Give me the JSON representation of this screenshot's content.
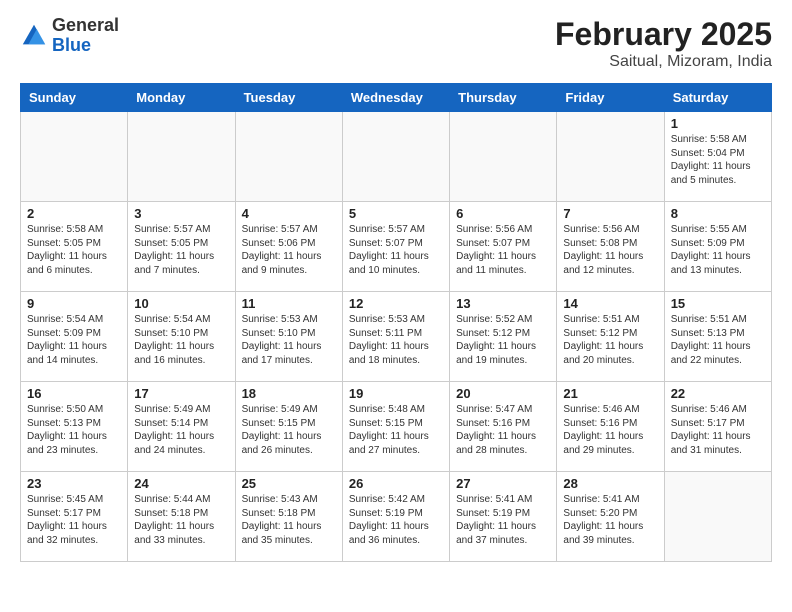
{
  "header": {
    "logo": {
      "general": "General",
      "blue": "Blue"
    },
    "title": "February 2025",
    "subtitle": "Saitual, Mizoram, India"
  },
  "calendar": {
    "days_of_week": [
      "Sunday",
      "Monday",
      "Tuesday",
      "Wednesday",
      "Thursday",
      "Friday",
      "Saturday"
    ],
    "weeks": [
      [
        {
          "day": null,
          "info": null
        },
        {
          "day": null,
          "info": null
        },
        {
          "day": null,
          "info": null
        },
        {
          "day": null,
          "info": null
        },
        {
          "day": null,
          "info": null
        },
        {
          "day": null,
          "info": null
        },
        {
          "day": "1",
          "info": "Sunrise: 5:58 AM\nSunset: 5:04 PM\nDaylight: 11 hours and 5 minutes."
        }
      ],
      [
        {
          "day": "2",
          "info": "Sunrise: 5:58 AM\nSunset: 5:05 PM\nDaylight: 11 hours and 6 minutes."
        },
        {
          "day": "3",
          "info": "Sunrise: 5:57 AM\nSunset: 5:05 PM\nDaylight: 11 hours and 7 minutes."
        },
        {
          "day": "4",
          "info": "Sunrise: 5:57 AM\nSunset: 5:06 PM\nDaylight: 11 hours and 9 minutes."
        },
        {
          "day": "5",
          "info": "Sunrise: 5:57 AM\nSunset: 5:07 PM\nDaylight: 11 hours and 10 minutes."
        },
        {
          "day": "6",
          "info": "Sunrise: 5:56 AM\nSunset: 5:07 PM\nDaylight: 11 hours and 11 minutes."
        },
        {
          "day": "7",
          "info": "Sunrise: 5:56 AM\nSunset: 5:08 PM\nDaylight: 11 hours and 12 minutes."
        },
        {
          "day": "8",
          "info": "Sunrise: 5:55 AM\nSunset: 5:09 PM\nDaylight: 11 hours and 13 minutes."
        }
      ],
      [
        {
          "day": "9",
          "info": "Sunrise: 5:54 AM\nSunset: 5:09 PM\nDaylight: 11 hours and 14 minutes."
        },
        {
          "day": "10",
          "info": "Sunrise: 5:54 AM\nSunset: 5:10 PM\nDaylight: 11 hours and 16 minutes."
        },
        {
          "day": "11",
          "info": "Sunrise: 5:53 AM\nSunset: 5:10 PM\nDaylight: 11 hours and 17 minutes."
        },
        {
          "day": "12",
          "info": "Sunrise: 5:53 AM\nSunset: 5:11 PM\nDaylight: 11 hours and 18 minutes."
        },
        {
          "day": "13",
          "info": "Sunrise: 5:52 AM\nSunset: 5:12 PM\nDaylight: 11 hours and 19 minutes."
        },
        {
          "day": "14",
          "info": "Sunrise: 5:51 AM\nSunset: 5:12 PM\nDaylight: 11 hours and 20 minutes."
        },
        {
          "day": "15",
          "info": "Sunrise: 5:51 AM\nSunset: 5:13 PM\nDaylight: 11 hours and 22 minutes."
        }
      ],
      [
        {
          "day": "16",
          "info": "Sunrise: 5:50 AM\nSunset: 5:13 PM\nDaylight: 11 hours and 23 minutes."
        },
        {
          "day": "17",
          "info": "Sunrise: 5:49 AM\nSunset: 5:14 PM\nDaylight: 11 hours and 24 minutes."
        },
        {
          "day": "18",
          "info": "Sunrise: 5:49 AM\nSunset: 5:15 PM\nDaylight: 11 hours and 26 minutes."
        },
        {
          "day": "19",
          "info": "Sunrise: 5:48 AM\nSunset: 5:15 PM\nDaylight: 11 hours and 27 minutes."
        },
        {
          "day": "20",
          "info": "Sunrise: 5:47 AM\nSunset: 5:16 PM\nDaylight: 11 hours and 28 minutes."
        },
        {
          "day": "21",
          "info": "Sunrise: 5:46 AM\nSunset: 5:16 PM\nDaylight: 11 hours and 29 minutes."
        },
        {
          "day": "22",
          "info": "Sunrise: 5:46 AM\nSunset: 5:17 PM\nDaylight: 11 hours and 31 minutes."
        }
      ],
      [
        {
          "day": "23",
          "info": "Sunrise: 5:45 AM\nSunset: 5:17 PM\nDaylight: 11 hours and 32 minutes."
        },
        {
          "day": "24",
          "info": "Sunrise: 5:44 AM\nSunset: 5:18 PM\nDaylight: 11 hours and 33 minutes."
        },
        {
          "day": "25",
          "info": "Sunrise: 5:43 AM\nSunset: 5:18 PM\nDaylight: 11 hours and 35 minutes."
        },
        {
          "day": "26",
          "info": "Sunrise: 5:42 AM\nSunset: 5:19 PM\nDaylight: 11 hours and 36 minutes."
        },
        {
          "day": "27",
          "info": "Sunrise: 5:41 AM\nSunset: 5:19 PM\nDaylight: 11 hours and 37 minutes."
        },
        {
          "day": "28",
          "info": "Sunrise: 5:41 AM\nSunset: 5:20 PM\nDaylight: 11 hours and 39 minutes."
        },
        {
          "day": null,
          "info": null
        }
      ]
    ]
  }
}
